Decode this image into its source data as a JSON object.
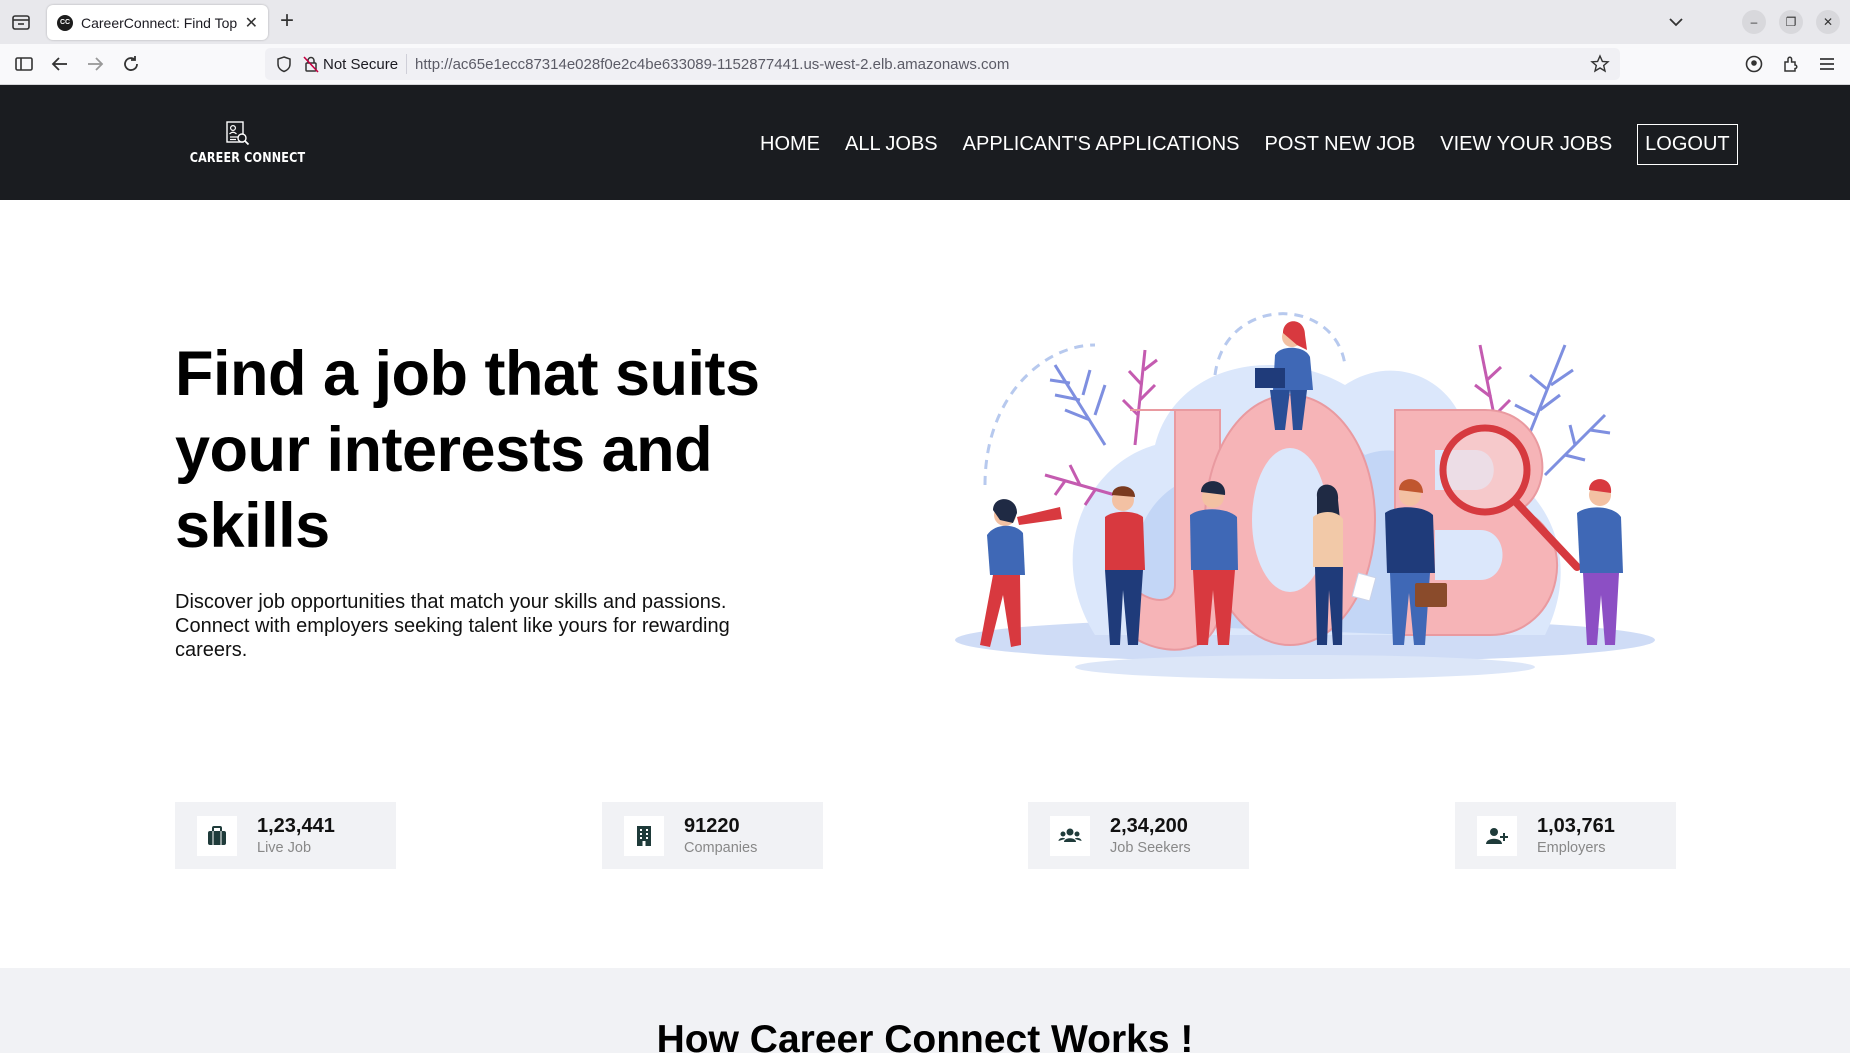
{
  "browser": {
    "tab_title": "CareerConnect: Find Top",
    "favicon_text": "CC",
    "not_secure": "Not Secure",
    "url": "http://ac65e1ecc87314e028f0e2c4be633089-1152877441.us-west-2.elb.amazonaws.com"
  },
  "header": {
    "logo_text": "CAREER CONNECT",
    "nav": {
      "home": "HOME",
      "all_jobs": "ALL JOBS",
      "applications": "APPLICANT'S APPLICATIONS",
      "post_job": "POST NEW JOB",
      "view_jobs": "VIEW YOUR JOBS",
      "logout": "LOGOUT"
    }
  },
  "hero": {
    "title": "Find a job that suits your interests and skills",
    "description": "Discover job opportunities that match your skills and passions. Connect with employers seeking talent like yours for rewarding careers."
  },
  "stats": [
    {
      "number": "1,23,441",
      "label": "Live Job",
      "icon": "briefcase-icon"
    },
    {
      "number": "91220",
      "label": "Companies",
      "icon": "building-icon"
    },
    {
      "number": "2,34,200",
      "label": "Job Seekers",
      "icon": "users-icon"
    },
    {
      "number": "1,03,761",
      "label": "Employers",
      "icon": "user-plus-icon"
    }
  ],
  "how": {
    "title": "How Career Connect Works !"
  },
  "colors": {
    "header_bg": "#1a1c20",
    "stat_bg": "#f1f2f5",
    "icon_color": "#1f3b3a",
    "job_letters": "#f6b4b7"
  }
}
